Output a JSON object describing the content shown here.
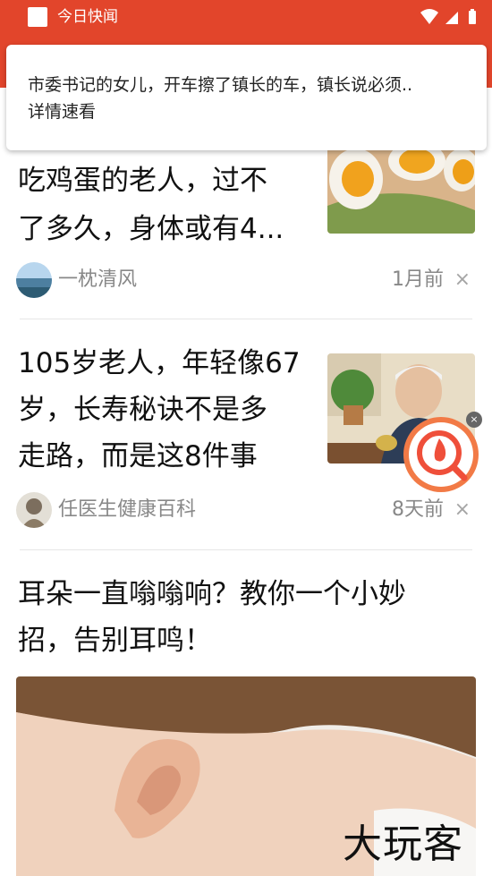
{
  "status_bar": {
    "app_title": "今日快闻"
  },
  "notification": {
    "line1": "市委书记的女儿，开车擦了镇长的车，镇长说必须..",
    "line2": "详情速看"
  },
  "feed": [
    {
      "headline_l1": "吃鸡蛋的老人，过不",
      "headline_l2": "了多久，身体或有4...",
      "source": "一枕清风",
      "time": "1月前",
      "close": "×"
    },
    {
      "headline_l1": "105岁老人，年轻像67",
      "headline_l2": "岁，长寿秘诀不是多",
      "headline_l3": "走路，而是这8件事",
      "source": "任医生健康百科",
      "time": "8天前",
      "close": "×"
    },
    {
      "headline_l1": "耳朵一直嗡嗡响？教你一个小妙",
      "headline_l2": "招，告别耳鸣！",
      "watermark": "大玩客"
    }
  ],
  "floating": {
    "close": "×"
  },
  "icons": {
    "app": "app-icon",
    "wifi": "wifi-icon",
    "signal": "signal-icon",
    "battery": "battery-icon",
    "float": "hot-search-icon"
  },
  "colors": {
    "brand_red": "#e2452b",
    "meta_grey": "#888888"
  }
}
